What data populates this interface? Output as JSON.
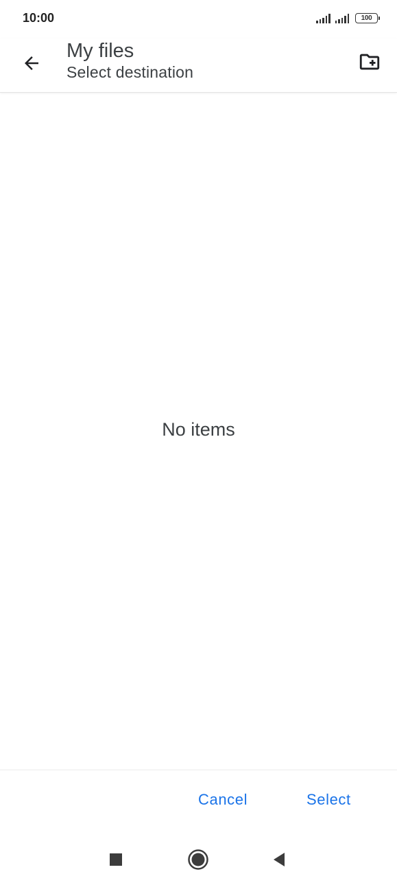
{
  "status_bar": {
    "time": "10:00",
    "battery": "100",
    "icons": [
      "signal-icon",
      "signal-icon",
      "battery-icon"
    ]
  },
  "app_bar": {
    "title": "My files",
    "subtitle": "Select destination",
    "back_icon": "arrow-back-icon",
    "new_folder_icon": "create-new-folder-icon"
  },
  "content": {
    "empty_message": "No items"
  },
  "actions": {
    "cancel_label": "Cancel",
    "select_label": "Select"
  },
  "navigation": {
    "icons": [
      "recents-square-icon",
      "home-circle-icon",
      "back-triangle-icon"
    ]
  },
  "colors": {
    "accent": "#1a73e8",
    "text_primary": "#3c4043",
    "background": "#ffffff"
  }
}
